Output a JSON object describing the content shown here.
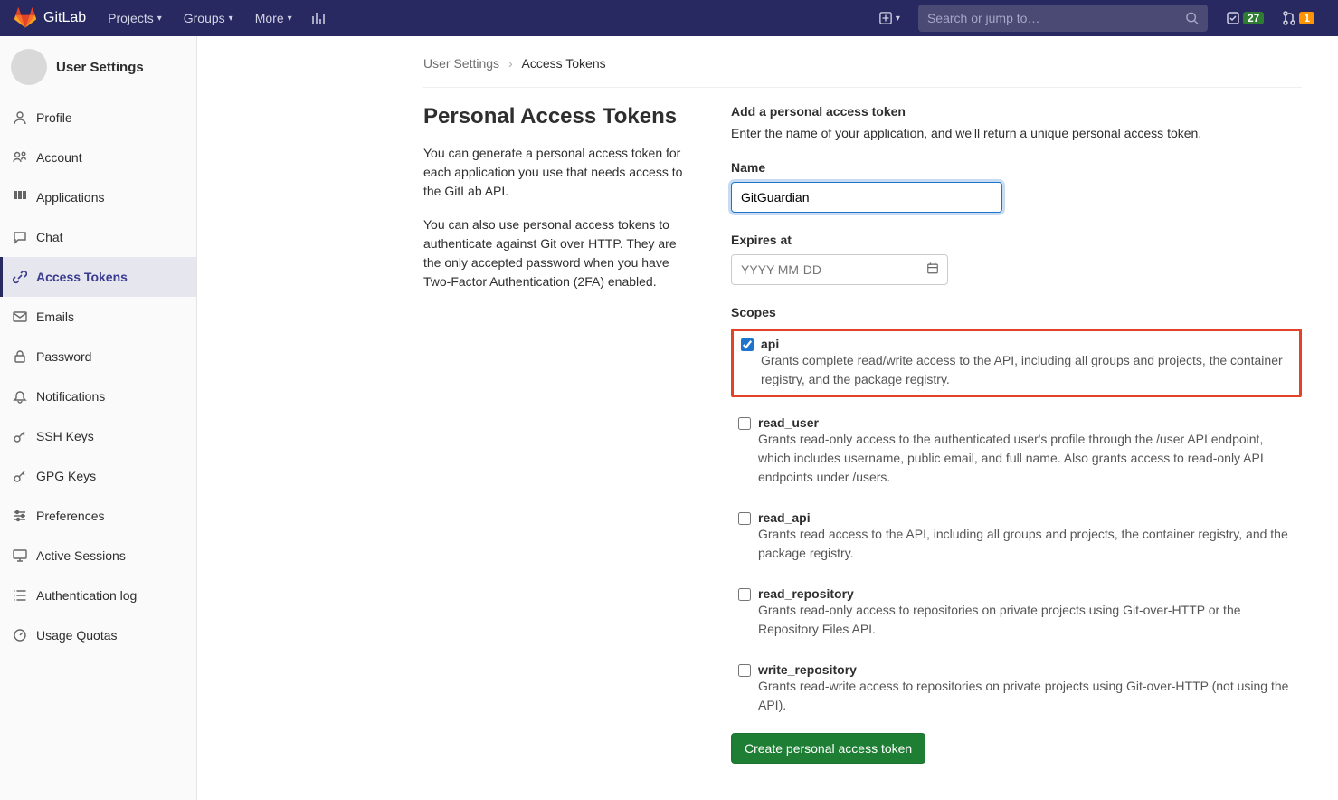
{
  "header": {
    "brand": "GitLab",
    "nav": [
      "Projects",
      "Groups",
      "More"
    ],
    "search_placeholder": "Search or jump to…",
    "todo_count": "27",
    "merge_count": "1"
  },
  "sidebar": {
    "title": "User Settings",
    "items": [
      {
        "label": "Profile",
        "icon": "👤"
      },
      {
        "label": "Account",
        "icon": "account"
      },
      {
        "label": "Applications",
        "icon": "apps"
      },
      {
        "label": "Chat",
        "icon": "chat"
      },
      {
        "label": "Access Tokens",
        "icon": "link",
        "active": true
      },
      {
        "label": "Emails",
        "icon": "mail"
      },
      {
        "label": "Password",
        "icon": "lock"
      },
      {
        "label": "Notifications",
        "icon": "bell"
      },
      {
        "label": "SSH Keys",
        "icon": "key"
      },
      {
        "label": "GPG Keys",
        "icon": "key"
      },
      {
        "label": "Preferences",
        "icon": "sliders"
      },
      {
        "label": "Active Sessions",
        "icon": "monitor"
      },
      {
        "label": "Authentication log",
        "icon": "list"
      },
      {
        "label": "Usage Quotas",
        "icon": "gauge"
      }
    ]
  },
  "breadcrumb": {
    "root": "User Settings",
    "current": "Access Tokens"
  },
  "page": {
    "title": "Personal Access Tokens",
    "desc1": "You can generate a personal access token for each application you use that needs access to the GitLab API.",
    "desc2": "You can also use personal access tokens to authenticate against Git over HTTP. They are the only accepted password when you have Two-Factor Authentication (2FA) enabled."
  },
  "form": {
    "heading": "Add a personal access token",
    "subheading": "Enter the name of your application, and we'll return a unique personal access token.",
    "name_label": "Name",
    "name_value": "GitGuardian",
    "expires_label": "Expires at",
    "expires_placeholder": "YYYY-MM-DD",
    "scopes_label": "Scopes",
    "scopes": [
      {
        "key": "api",
        "desc": "Grants complete read/write access to the API, including all groups and projects, the container registry, and the package registry.",
        "checked": true,
        "highlight": true
      },
      {
        "key": "read_user",
        "desc": "Grants read-only access to the authenticated user's profile through the /user API endpoint, which includes username, public email, and full name. Also grants access to read-only API endpoints under /users.",
        "checked": false
      },
      {
        "key": "read_api",
        "desc": "Grants read access to the API, including all groups and projects, the container registry, and the package registry.",
        "checked": false
      },
      {
        "key": "read_repository",
        "desc": "Grants read-only access to repositories on private projects using Git-over-HTTP or the Repository Files API.",
        "checked": false
      },
      {
        "key": "write_repository",
        "desc": "Grants read-write access to repositories on private projects using Git-over-HTTP (not using the API).",
        "checked": false
      }
    ],
    "submit": "Create personal access token"
  }
}
